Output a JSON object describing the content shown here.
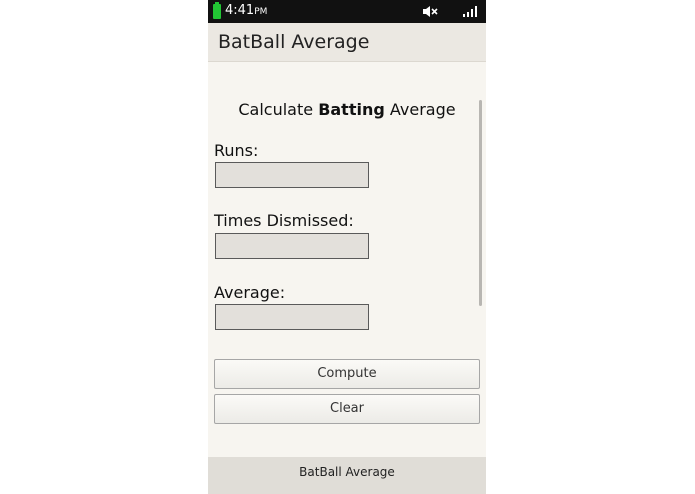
{
  "status_bar": {
    "time": "4:41",
    "ampm": "PM",
    "battery_color": "#22c534",
    "icons": [
      "battery-icon",
      "mute-icon",
      "signal-icon"
    ]
  },
  "app_bar": {
    "title": "BatBall Average"
  },
  "form": {
    "heading_prefix": "Calculate ",
    "heading_bold": "Batting",
    "heading_suffix": " Average",
    "runs_label": "Runs:",
    "runs_value": "",
    "dismissed_label": "Times Dismissed:",
    "dismissed_value": "",
    "average_label": "Average:",
    "average_value": ""
  },
  "buttons": {
    "compute": "Compute",
    "clear": "Clear"
  },
  "footer": {
    "title": "BatBall Average"
  }
}
